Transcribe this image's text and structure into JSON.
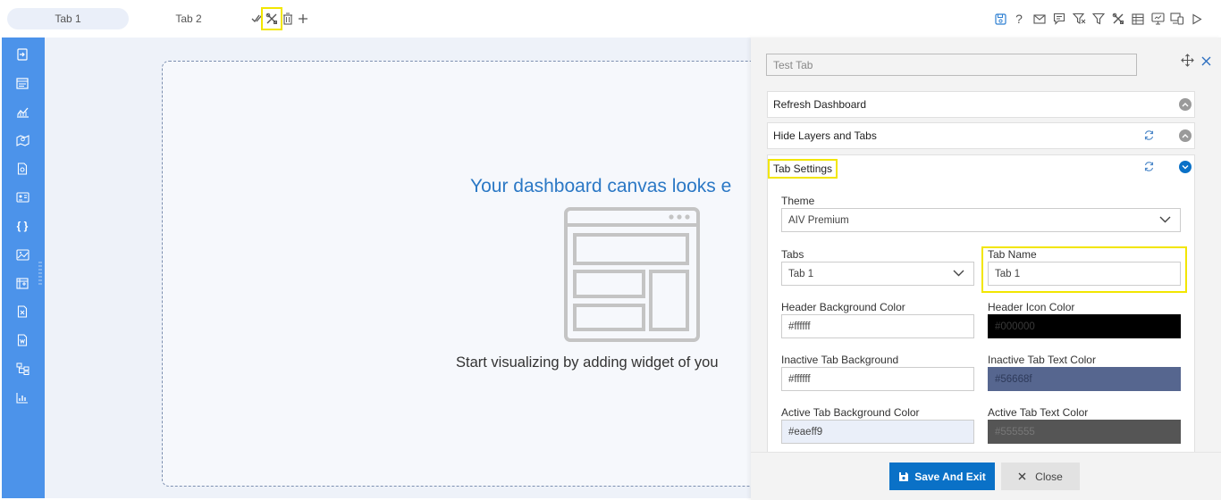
{
  "tabs": [
    {
      "label": "Tab 1"
    },
    {
      "label": "Tab 2"
    }
  ],
  "canvas": {
    "title": "Your dashboard canvas looks e",
    "subtitle": "Start visualizing by adding widget of you"
  },
  "panel": {
    "tab_name_value": "Test Tab",
    "sections": {
      "refresh": "Refresh Dashboard",
      "hide_layers": "Hide Layers and Tabs",
      "tab_settings": "Tab Settings"
    },
    "fields": {
      "theme_label": "Theme",
      "theme_value": "AIV Premium",
      "tabs_label": "Tabs",
      "tabs_value": "Tab 1",
      "tab_name_label": "Tab Name",
      "tab_name_value": "Tab 1",
      "header_bg_label": "Header Background Color",
      "header_bg_value": "#ffffff",
      "header_icon_label": "Header Icon Color",
      "header_icon_value": "#000000",
      "inactive_bg_label": "Inactive Tab Background",
      "inactive_bg_value": "#ffffff",
      "inactive_text_label": "Inactive Tab Text Color",
      "inactive_text_value": "#56668f",
      "active_bg_label": "Active Tab Background Color",
      "active_bg_value": "#eaeff9",
      "active_text_label": "Active Tab Text Color",
      "active_text_value": "#555555"
    },
    "buttons": {
      "save": "Save And Exit",
      "close": "Close"
    }
  },
  "colors": {
    "sidebar": "#4c93ea",
    "accent": "#0a71c7",
    "highlight": "#f2e600",
    "title_blue": "#2b78c5"
  }
}
